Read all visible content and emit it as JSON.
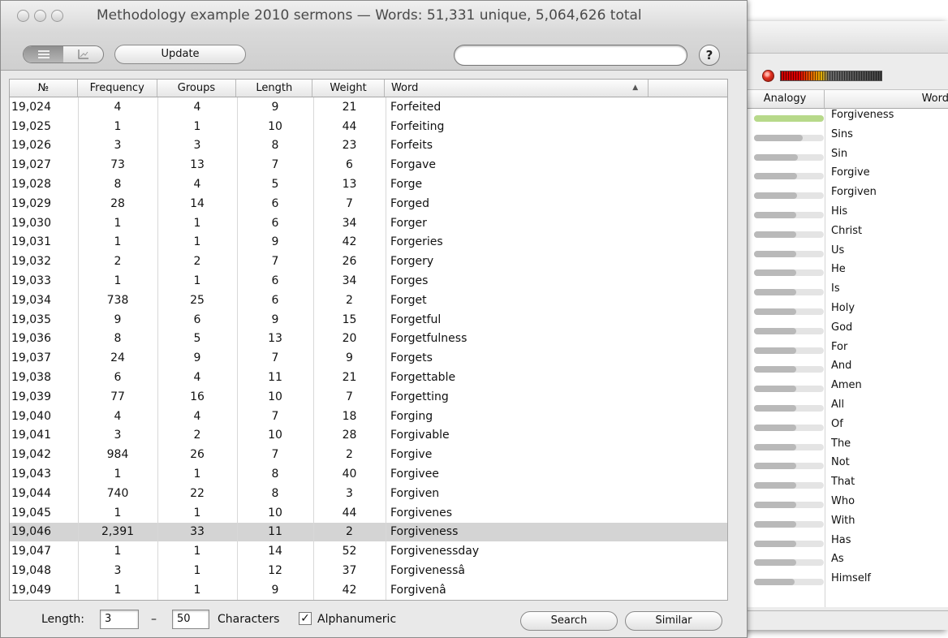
{
  "window": {
    "title": "Methodology example 2010 sermons — Words: 51,331 unique, 5,064,626 total"
  },
  "toolbar": {
    "view_list_icon": "list-view-icon",
    "view_chart_icon": "chart-view-icon",
    "update_label": "Update",
    "search_value": "",
    "help_label": "?"
  },
  "table": {
    "headers": {
      "no": "№",
      "frequency": "Frequency",
      "groups": "Groups",
      "length": "Length",
      "weight": "Weight",
      "word": "Word",
      "sort_indicator": "▲"
    },
    "rows": [
      {
        "no": "19,024",
        "frequency": "4",
        "groups": "4",
        "length": "9",
        "weight": "21",
        "word": "Forfeited"
      },
      {
        "no": "19,025",
        "frequency": "1",
        "groups": "1",
        "length": "10",
        "weight": "44",
        "word": "Forfeiting"
      },
      {
        "no": "19,026",
        "frequency": "3",
        "groups": "3",
        "length": "8",
        "weight": "23",
        "word": "Forfeits"
      },
      {
        "no": "19,027",
        "frequency": "73",
        "groups": "13",
        "length": "7",
        "weight": "6",
        "word": "Forgave"
      },
      {
        "no": "19,028",
        "frequency": "8",
        "groups": "4",
        "length": "5",
        "weight": "13",
        "word": "Forge"
      },
      {
        "no": "19,029",
        "frequency": "28",
        "groups": "14",
        "length": "6",
        "weight": "7",
        "word": "Forged"
      },
      {
        "no": "19,030",
        "frequency": "1",
        "groups": "1",
        "length": "6",
        "weight": "34",
        "word": "Forger"
      },
      {
        "no": "19,031",
        "frequency": "1",
        "groups": "1",
        "length": "9",
        "weight": "42",
        "word": "Forgeries"
      },
      {
        "no": "19,032",
        "frequency": "2",
        "groups": "2",
        "length": "7",
        "weight": "26",
        "word": "Forgery"
      },
      {
        "no": "19,033",
        "frequency": "1",
        "groups": "1",
        "length": "6",
        "weight": "34",
        "word": "Forges"
      },
      {
        "no": "19,034",
        "frequency": "738",
        "groups": "25",
        "length": "6",
        "weight": "2",
        "word": "Forget"
      },
      {
        "no": "19,035",
        "frequency": "9",
        "groups": "6",
        "length": "9",
        "weight": "15",
        "word": "Forgetful"
      },
      {
        "no": "19,036",
        "frequency": "8",
        "groups": "5",
        "length": "13",
        "weight": "20",
        "word": "Forgetfulness"
      },
      {
        "no": "19,037",
        "frequency": "24",
        "groups": "9",
        "length": "7",
        "weight": "9",
        "word": "Forgets"
      },
      {
        "no": "19,038",
        "frequency": "6",
        "groups": "4",
        "length": "11",
        "weight": "21",
        "word": "Forgettable"
      },
      {
        "no": "19,039",
        "frequency": "77",
        "groups": "16",
        "length": "10",
        "weight": "7",
        "word": "Forgetting"
      },
      {
        "no": "19,040",
        "frequency": "4",
        "groups": "4",
        "length": "7",
        "weight": "18",
        "word": "Forging"
      },
      {
        "no": "19,041",
        "frequency": "3",
        "groups": "2",
        "length": "10",
        "weight": "28",
        "word": "Forgivable"
      },
      {
        "no": "19,042",
        "frequency": "984",
        "groups": "26",
        "length": "7",
        "weight": "2",
        "word": "Forgive"
      },
      {
        "no": "19,043",
        "frequency": "1",
        "groups": "1",
        "length": "8",
        "weight": "40",
        "word": "Forgivee"
      },
      {
        "no": "19,044",
        "frequency": "740",
        "groups": "22",
        "length": "8",
        "weight": "3",
        "word": "Forgiven"
      },
      {
        "no": "19,045",
        "frequency": "1",
        "groups": "1",
        "length": "10",
        "weight": "44",
        "word": "Forgivenes"
      },
      {
        "no": "19,046",
        "frequency": "2,391",
        "groups": "33",
        "length": "11",
        "weight": "2",
        "word": "Forgiveness",
        "selected": true
      },
      {
        "no": "19,047",
        "frequency": "1",
        "groups": "1",
        "length": "14",
        "weight": "52",
        "word": "Forgivenessday"
      },
      {
        "no": "19,048",
        "frequency": "3",
        "groups": "1",
        "length": "12",
        "weight": "37",
        "word": "Forgivenessâ"
      },
      {
        "no": "19,049",
        "frequency": "1",
        "groups": "1",
        "length": "9",
        "weight": "42",
        "word": "Forgivenâ"
      }
    ]
  },
  "filter": {
    "length_label": "Length:",
    "length_min": "3",
    "dash": "–",
    "length_max": "50",
    "characters_label": "Characters",
    "alphanumeric_label": "Alphanumeric",
    "alphanumeric_checked": true,
    "check_mark": "✓",
    "search_label": "Search",
    "similar_label": "Similar"
  },
  "analogy": {
    "headers": {
      "analogy": "Analogy",
      "word": "Word"
    },
    "accent_color": "#b7d98a",
    "items": [
      {
        "word": "Forgiveness",
        "strength": 1.0,
        "highlight": true
      },
      {
        "word": "Sins",
        "strength": 0.7
      },
      {
        "word": "Sin",
        "strength": 0.63
      },
      {
        "word": "Forgive",
        "strength": 0.62
      },
      {
        "word": "Forgiven",
        "strength": 0.62
      },
      {
        "word": "His",
        "strength": 0.61
      },
      {
        "word": "Christ",
        "strength": 0.61
      },
      {
        "word": "Us",
        "strength": 0.61
      },
      {
        "word": "He",
        "strength": 0.61
      },
      {
        "word": "Is",
        "strength": 0.6
      },
      {
        "word": "Holy",
        "strength": 0.6
      },
      {
        "word": "God",
        "strength": 0.6
      },
      {
        "word": "For",
        "strength": 0.6
      },
      {
        "word": "And",
        "strength": 0.6
      },
      {
        "word": "Amen",
        "strength": 0.6
      },
      {
        "word": "All",
        "strength": 0.6
      },
      {
        "word": "Of",
        "strength": 0.6
      },
      {
        "word": "The",
        "strength": 0.6
      },
      {
        "word": "Not",
        "strength": 0.6
      },
      {
        "word": "That",
        "strength": 0.6
      },
      {
        "word": "Who",
        "strength": 0.6
      },
      {
        "word": "With",
        "strength": 0.6
      },
      {
        "word": "Has",
        "strength": 0.6
      },
      {
        "word": "As",
        "strength": 0.6
      },
      {
        "word": "Himself",
        "strength": 0.58
      }
    ]
  }
}
